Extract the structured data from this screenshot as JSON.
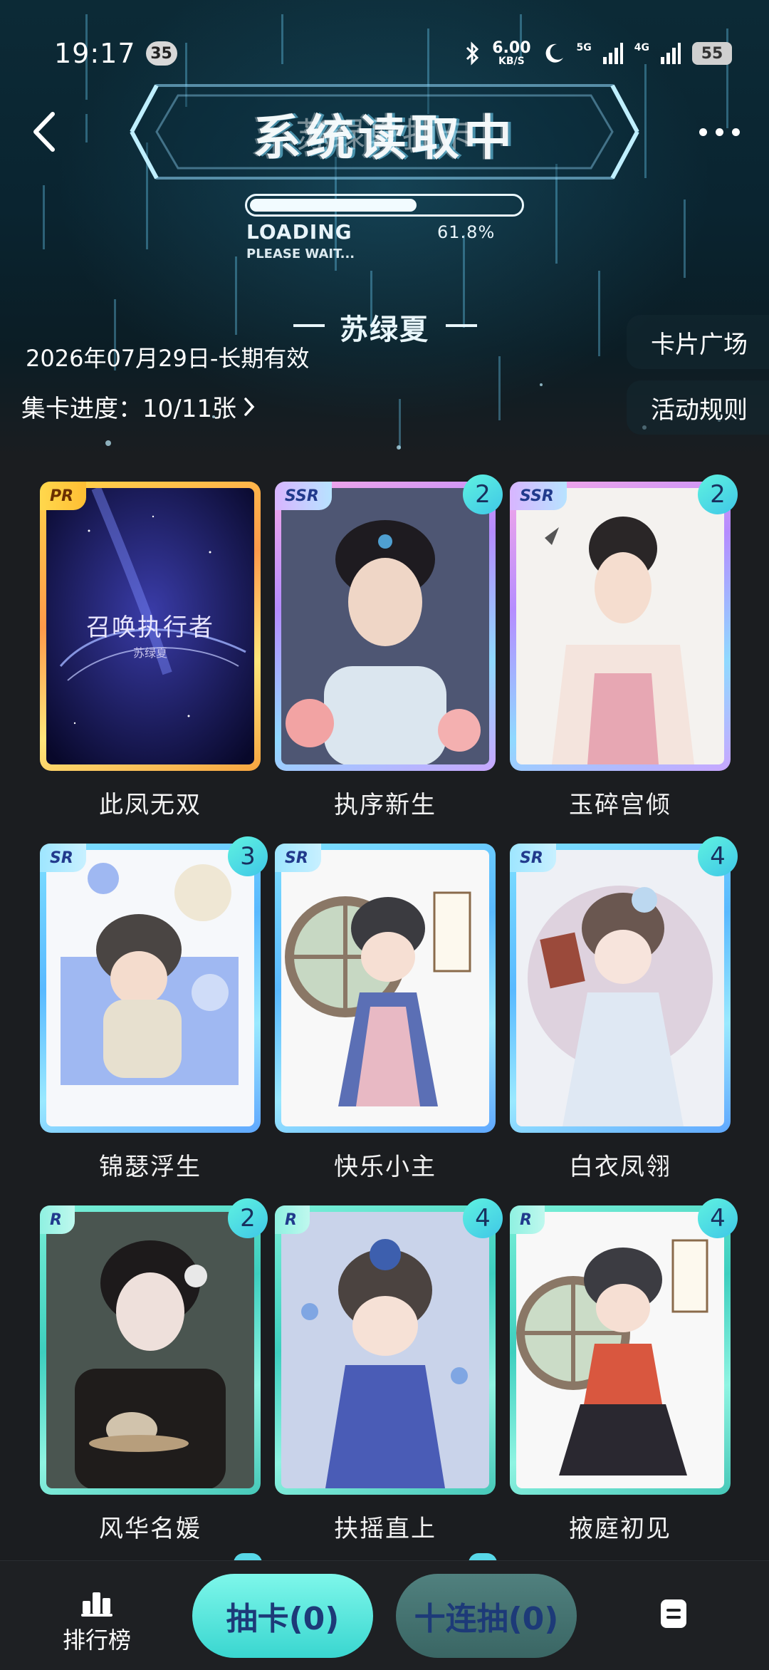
{
  "status_bar": {
    "time": "19:17",
    "notification_count": "35",
    "net_speed_value": "6.00",
    "net_speed_unit": "KB/S",
    "signal_1": "5G",
    "signal_2": "4G",
    "battery": "55"
  },
  "header": {
    "title": "系统读取中",
    "title_overlay": "苏绿夏抽卡",
    "loading_label": "LOADING",
    "loading_percent": "61.8%",
    "loading_progress": 0.618,
    "please_wait": "PLEASE WAIT..."
  },
  "collection": {
    "owner": "苏绿夏",
    "validity": "2026年07月29日-长期有效",
    "progress_text": "集卡进度：10/11张",
    "card_plaza": "卡片广场",
    "activity_rules": "活动规则"
  },
  "cards": [
    {
      "name": "此凤无双",
      "rarity": "PR",
      "count": "",
      "art_title": "召唤执行者",
      "art_sub": "苏绿夏"
    },
    {
      "name": "执序新生",
      "rarity": "SSR",
      "count": "2"
    },
    {
      "name": "玉碎宫倾",
      "rarity": "SSR",
      "count": "2"
    },
    {
      "name": "锦瑟浮生",
      "rarity": "SR",
      "count": "3"
    },
    {
      "name": "快乐小主",
      "rarity": "SR",
      "count": ""
    },
    {
      "name": "白衣凤翎",
      "rarity": "SR",
      "count": "4"
    },
    {
      "name": "风华名媛",
      "rarity": "R",
      "count": "2"
    },
    {
      "name": "扶摇直上",
      "rarity": "R",
      "count": "4"
    },
    {
      "name": "掖庭初见",
      "rarity": "R",
      "count": "4"
    }
  ],
  "bottom_bar": {
    "rank_label": "排行榜",
    "draw_label": "抽卡(0)",
    "draw_ten_label": "十连抽(0)"
  },
  "icons": {
    "back": "back-arrow-icon",
    "more": "more-dots-icon",
    "bluetooth": "bluetooth-icon",
    "moon": "moon-icon",
    "signal": "signal-bars-icon",
    "rank": "ranking-bars-icon",
    "notes": "notes-icon"
  },
  "colors": {
    "background": "#1b1d20",
    "accent_teal": "#4fe3dc",
    "rarity_pr": "#ffc640",
    "rarity_ssr": "#c49bff",
    "rarity_sr": "#62c2ff",
    "rarity_r": "#49d7c5"
  }
}
